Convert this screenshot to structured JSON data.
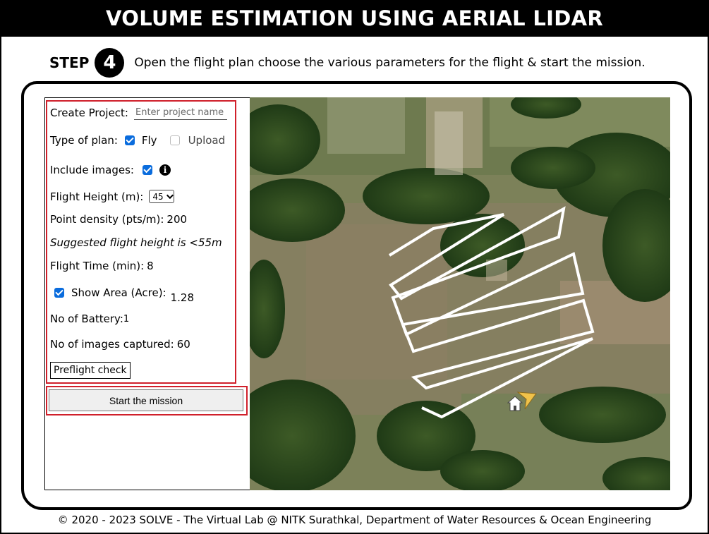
{
  "page": {
    "title": "VOLUME ESTIMATION USING AERIAL LIDAR",
    "footer": "© 2020 - 2023 SOLVE - The Virtual Lab @ NITK Surathkal, Department of Water Resources & Ocean Engineering"
  },
  "step": {
    "label": "STEP",
    "number": "4",
    "instruction": "Open the flight plan choose the various parameters for the flight & start the mission."
  },
  "form": {
    "create_project_label": "Create Project:",
    "project_placeholder": "Enter project name",
    "type_of_plan_label": "Type of plan:",
    "fly_label": "Fly",
    "fly_checked": true,
    "upload_label": "Upload",
    "upload_checked": false,
    "include_images_label": "Include images:",
    "include_images_checked": true,
    "flight_height_label": "Flight Height (m):",
    "flight_height_value": "45",
    "point_density_label": "Point density (pts/m):",
    "point_density_value": "200",
    "suggestion": "Suggested flight height is <55m",
    "flight_time_label": "Flight Time (min):",
    "flight_time_value": "8",
    "show_area_label": "Show Area (Acre):",
    "show_area_checked": true,
    "area_value": "1.28",
    "battery_label": "No of Battery:",
    "battery_value": "1",
    "images_captured_label": "No of images captured:",
    "images_captured_value": "60",
    "preflight_button": "Preflight check",
    "start_button": "Start the mission"
  },
  "colors": {
    "highlight": "#d0202b",
    "checkbox": "#0a6cdd",
    "flight_path": "#ffffff",
    "drone_marker": "#f0c24a"
  },
  "icons": {
    "info": "info-icon",
    "home": "home-icon",
    "drone": "drone-arrow-icon"
  }
}
